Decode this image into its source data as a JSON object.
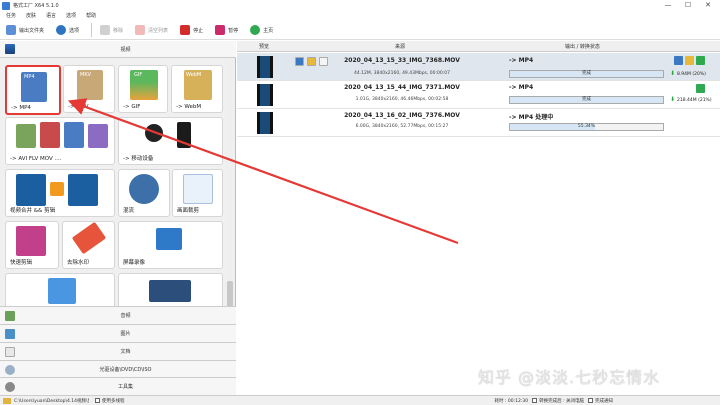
{
  "window": {
    "title": "格式工厂 X64 5.1.0",
    "minimize": "—",
    "maximize": "☐",
    "close": "✕"
  },
  "menu": [
    "任务",
    "皮肤",
    "语言",
    "选项",
    "帮助"
  ],
  "toolbar": {
    "output_folder": "输出文件夹",
    "options": "选项",
    "remove": "移除",
    "clear_list": "清空列表",
    "stop": "停止",
    "start": "暂停",
    "home": "主页"
  },
  "left": {
    "header": "视频",
    "tiles": [
      {
        "label": "-> MP4",
        "badge": "MP4"
      },
      {
        "label": "-> MKV",
        "badge": "MKV"
      },
      {
        "label": "-> GIF",
        "badge": "GIF"
      },
      {
        "label": "-> WebM",
        "badge": "WebM"
      },
      {
        "label": "-> AVI FLV MOV ....",
        "badges": [
          "AVI",
          "FLV",
          "MOV",
          "WMV"
        ]
      },
      {
        "label": "-> 移动设备"
      },
      {
        "label": "视频合并 && 剪辑"
      },
      {
        "label": "混流"
      },
      {
        "label": "画面裁剪"
      },
      {
        "label": "快速剪辑"
      },
      {
        "label": "去除水印"
      },
      {
        "label": "屏幕录像"
      },
      {
        "label": ""
      },
      {
        "label": ""
      }
    ],
    "categories": [
      "音频",
      "图片",
      "文档",
      "光驱设备\\DVD\\CD\\ISO",
      "工具集"
    ]
  },
  "status": {
    "path": "C:\\Users\\yuan\\Desktop\\4.14视频\\剪辑",
    "multithread": "使用多线程",
    "elapsed_label": "耗时 : 00:12:30",
    "notify": "转换完成后 : 关闭电脑",
    "notify2": "完成通知"
  },
  "table": {
    "headers": {
      "preview": "预览",
      "source": "来源",
      "output": "输出 / 转换状态"
    },
    "rows": [
      {
        "name": "2020_04_13_15_33_IMG_7368.MOV",
        "meta": "44.12M, 3840x2160, 49.43Mbps, 00:00:07",
        "format": "-> MP4",
        "status": "完成",
        "progress": 1.0,
        "size": "8.94M",
        "pct": "(20%)"
      },
      {
        "name": "2020_04_13_15_44_IMG_7371.MOV",
        "meta": "1.01G, 3840x2160, 46.46Mbps, 00:02:58",
        "format": "-> MP4",
        "status": "完成",
        "progress": 1.0,
        "size": "218.44M",
        "pct": "(21%)"
      },
      {
        "name": "2020_04_13_16_02_IMG_7376.MOV",
        "meta": "6.00G, 3840x2160, 52.77Mbps, 00:15:27",
        "format": "-> MP4 处理中",
        "status": "55.34%",
        "progress": 0.5534,
        "size": "",
        "pct": ""
      }
    ]
  },
  "watermark": "知乎 @淡淡.七秒忘情水",
  "colors": {
    "accent_red": "#e53935",
    "ok_green": "#26a641"
  }
}
